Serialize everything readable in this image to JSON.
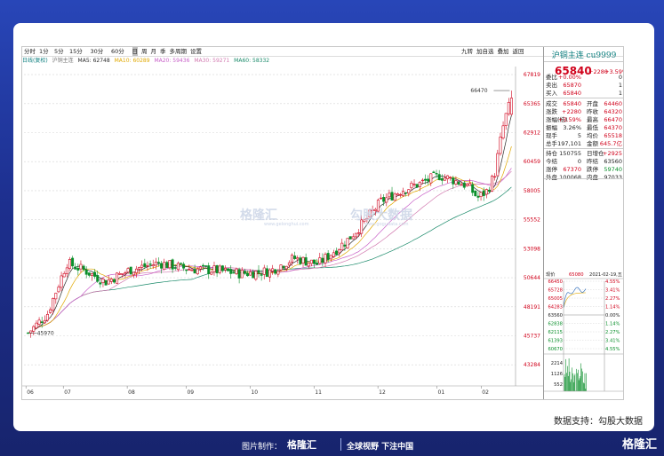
{
  "colors": {
    "up": "#d0021b",
    "down": "#0a8f2b",
    "ma5": "#2a2a2a",
    "ma10": "#e0a800",
    "ma20": "#c860c8",
    "ma30": "#d27ab0",
    "ma60": "#1a8a6a",
    "accent": "#0a7d7d"
  },
  "toolbar": {
    "left": [
      "分时",
      "1分",
      "5分",
      "15分",
      "30分",
      "60分",
      "日",
      "周",
      "月",
      "季",
      "多周期",
      "设置"
    ],
    "selected": "日",
    "right": [
      "九转",
      "加自选",
      "叠加",
      "返回"
    ]
  },
  "legend": {
    "main_label": "日线(复权)",
    "sub_label": "沪铜主连",
    "ma5": "MA5: 62748",
    "ma10": "MA10: 60289",
    "ma20": "MA20: 59436",
    "ma30": "MA30: 59271",
    "ma60": "MA60: 58332"
  },
  "chart_data": {
    "type": "candlestick",
    "y_ticks": [
      "67819",
      "65365",
      "62912",
      "60459",
      "58005",
      "55552",
      "53098",
      "50644",
      "48191",
      "45737",
      "43284"
    ],
    "x_ticks": [
      "06",
      "07",
      "08",
      "09",
      "10",
      "11",
      "12",
      "01",
      "02"
    ],
    "high_label": "66470",
    "low_label": "45970",
    "ylim": [
      41500,
      68500
    ]
  },
  "quote": {
    "title": "沪铜主连 cu9999",
    "price": "65840",
    "change": "+2280",
    "pct": "+3.59%",
    "rows": [
      [
        "委比",
        "+0.00%",
        "",
        "0"
      ],
      [
        "卖出",
        "65870",
        "",
        "1"
      ],
      [
        "买入",
        "65840",
        "",
        "1"
      ],
      [
        "成交",
        "65840",
        "开盘",
        "64460"
      ],
      [
        "涨跌",
        "+2280",
        "昨收",
        "64320"
      ],
      [
        "涨幅(结)",
        "+3.59%",
        "最高",
        "66470"
      ],
      [
        "振幅",
        "3.26%",
        "最低",
        "64370"
      ],
      [
        "现手",
        "5",
        "均价",
        "65518"
      ],
      [
        "总手",
        "197,101",
        "金额",
        "645.7亿"
      ],
      [
        "持仓",
        "150755",
        "日增仓",
        "+2925"
      ],
      [
        "今结",
        "0",
        "昨结",
        "63560"
      ],
      [
        "涨停",
        "67370",
        "跌停",
        "59740"
      ],
      [
        "外盘",
        "100068",
        "内盘",
        "97033"
      ]
    ],
    "mini": {
      "label_now": "现价",
      "price": "65080",
      "date": "2021-02-19,五",
      "left_ticks": [
        "66450",
        "65728",
        "65005",
        "64283",
        "63560",
        "62838",
        "62115",
        "61393",
        "60670"
      ],
      "right_ticks": [
        "4.55%",
        "3.41%",
        "2.27%",
        "1.14%",
        "0.00%",
        "1.14%",
        "2.27%",
        "3.41%",
        "4.55%"
      ],
      "vol_ticks": [
        "2214",
        "1126",
        "552"
      ]
    }
  },
  "watermark": {
    "name": "格隆汇",
    "site": "www.gelonghui.com",
    "name2": "勾股大数据",
    "site2": "www.gogudata.com"
  },
  "data_support": "数据支持：勾股大数据",
  "footer": {
    "made_by": "图片制作：",
    "logo": "格隆汇",
    "slogan": "全球视野 下注中国"
  }
}
